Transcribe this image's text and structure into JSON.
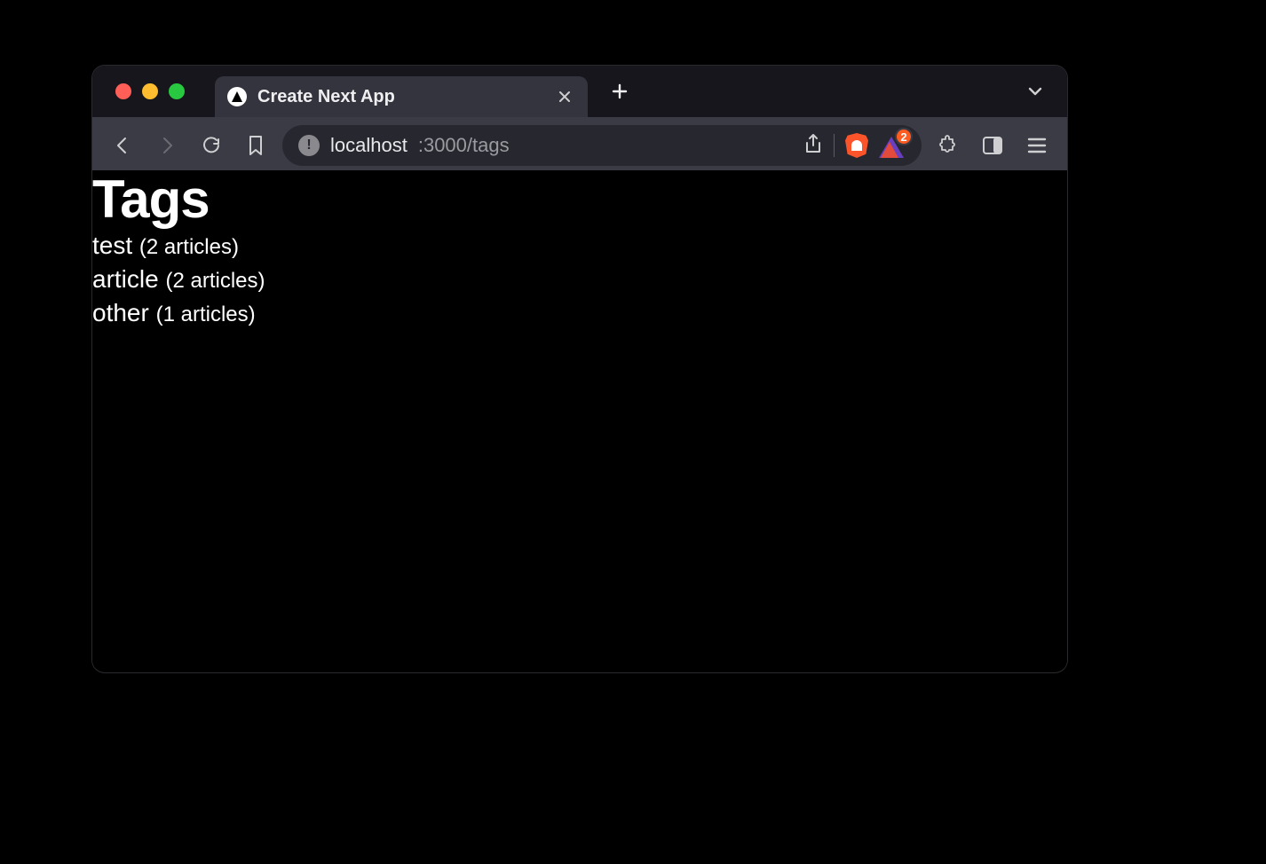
{
  "browser": {
    "tab_title": "Create Next App",
    "url_host": "localhost",
    "url_path": ":3000/tags",
    "badge_count": "2"
  },
  "page": {
    "heading": "Tags",
    "tags": [
      {
        "name": "test",
        "count_label": "(2 articles)"
      },
      {
        "name": "article",
        "count_label": "(2 articles)"
      },
      {
        "name": "other",
        "count_label": "(1 articles)"
      }
    ]
  }
}
